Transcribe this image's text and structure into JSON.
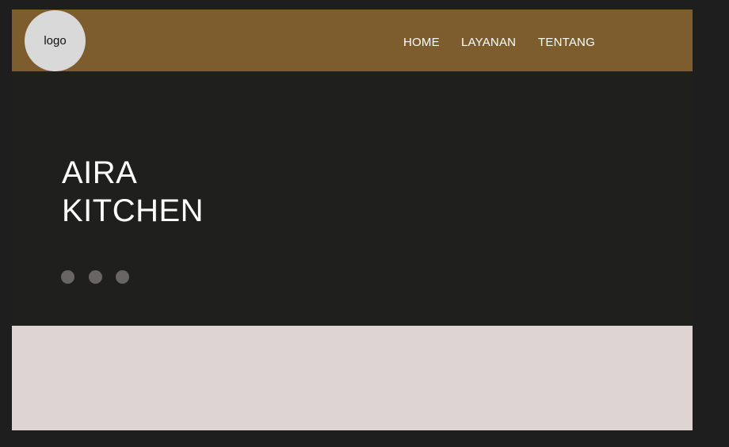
{
  "header": {
    "logo_text": "logo",
    "nav": [
      {
        "label": "HOME"
      },
      {
        "label": "LAYANAN"
      },
      {
        "label": "TENTANG"
      }
    ]
  },
  "hero": {
    "title_line1": "AIRA",
    "title_line2": "KITCHEN",
    "carousel_dots": 3
  },
  "colors": {
    "page_bg": "#1e1e1e",
    "frame_bg": "#1f201e",
    "header_bg": "#7d5d2d",
    "logo_bg": "#d9d9d9",
    "dot": "#676665",
    "footer_band": "#dfd4d4"
  }
}
